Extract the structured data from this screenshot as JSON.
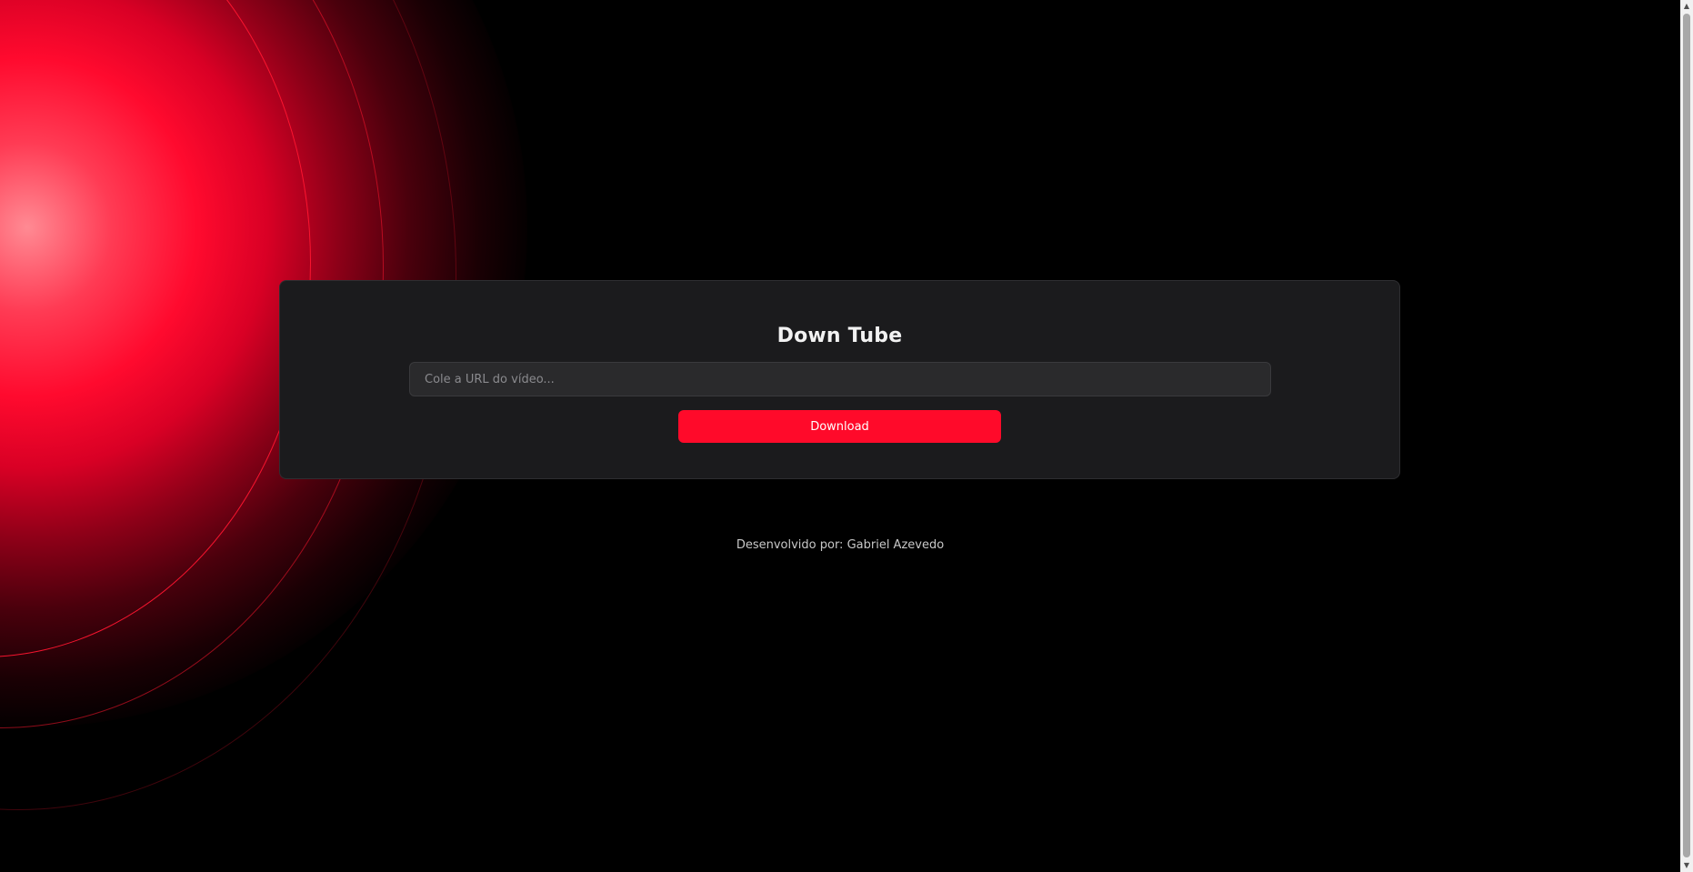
{
  "app": {
    "title": "Down Tube"
  },
  "form": {
    "url_placeholder": "Cole a URL do vídeo...",
    "url_value": "",
    "download_label": "Download"
  },
  "footer": {
    "credit": "Desenvolvido por: Gabriel Azevedo"
  },
  "scrollbar": {
    "up_icon": "▲",
    "down_icon": "▼"
  },
  "colors": {
    "accent": "#ff0a2a",
    "background": "#000000",
    "card": "#1b1b1d"
  }
}
